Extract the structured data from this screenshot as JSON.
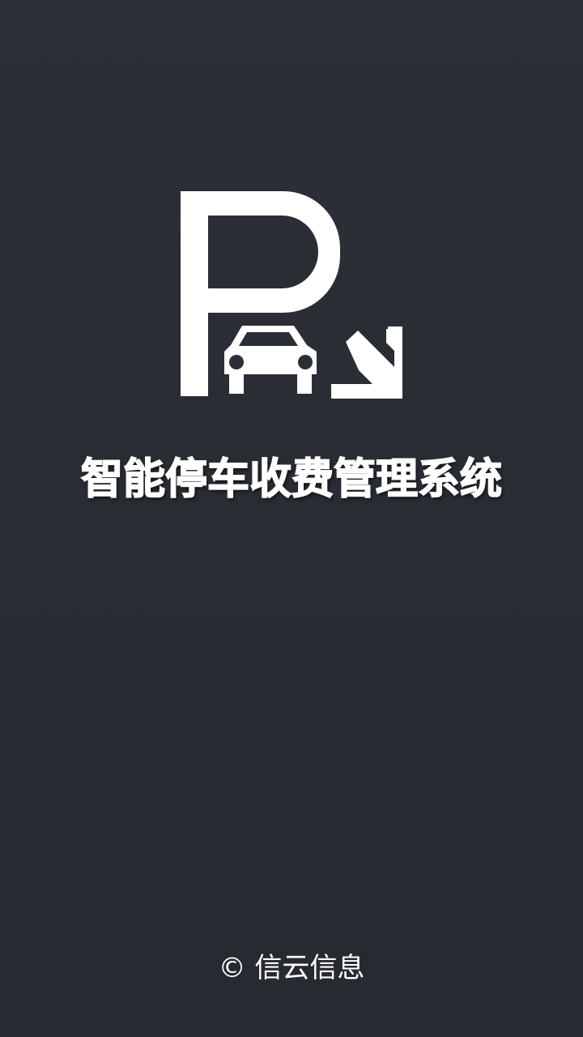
{
  "app": {
    "logo_icon": "parking-car-arrow-icon",
    "title": "智能停车收费管理系统"
  },
  "footer": {
    "copyright": "© 信云信息"
  },
  "colors": {
    "background": "#2a2d34",
    "foreground": "#ffffff"
  }
}
